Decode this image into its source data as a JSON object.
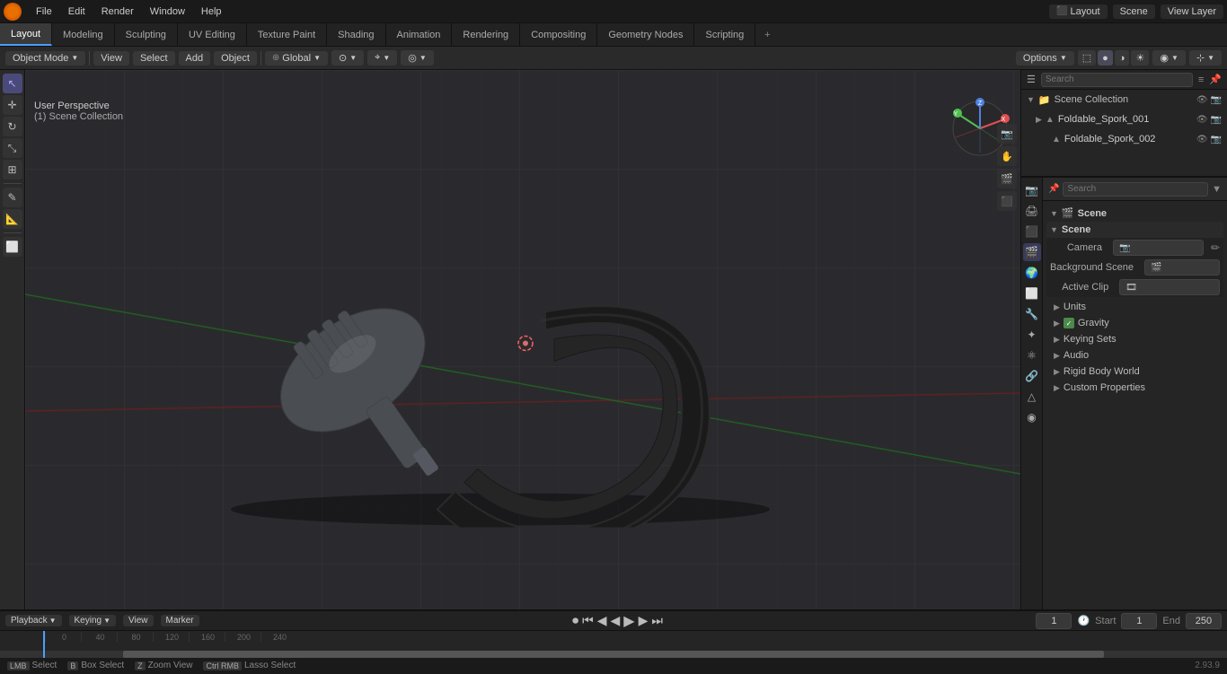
{
  "app": {
    "title": "Blender",
    "version": "2.93.9"
  },
  "top_menu": {
    "items": [
      "File",
      "Edit",
      "Render",
      "Window",
      "Help"
    ]
  },
  "workspace_tabs": {
    "tabs": [
      "Layout",
      "Modeling",
      "Sculpting",
      "UV Editing",
      "Texture Paint",
      "Shading",
      "Animation",
      "Rendering",
      "Compositing",
      "Geometry Nodes",
      "Scripting"
    ],
    "active": "Layout"
  },
  "header_tools": {
    "mode": "Object Mode",
    "view_label": "View",
    "select_label": "Select",
    "add_label": "Add",
    "object_label": "Object",
    "transform": "Global",
    "pivot": "⊙"
  },
  "viewport": {
    "view_label": "User Perspective",
    "scene_label": "(1) Scene Collection"
  },
  "outliner": {
    "title": "Scene Collection",
    "search_placeholder": "Search",
    "items": [
      {
        "name": "Scene Collection",
        "indent": 0,
        "type": "collection",
        "expanded": true
      },
      {
        "name": "Foldable_Spork_001",
        "indent": 1,
        "type": "mesh",
        "visible": true
      },
      {
        "name": "Foldable_Spork_002",
        "indent": 2,
        "type": "mesh",
        "visible": true
      }
    ]
  },
  "properties": {
    "search_placeholder": "Search",
    "active_tab": "scene",
    "scene_section": {
      "label": "Scene",
      "camera_label": "Camera",
      "camera_value": "",
      "background_scene_label": "Background Scene",
      "active_clip_label": "Active Clip",
      "units_label": "Units",
      "gravity_label": "Gravity",
      "gravity_checked": true,
      "keying_sets_label": "Keying Sets",
      "audio_label": "Audio",
      "rigid_body_world_label": "Rigid Body World",
      "custom_properties_label": "Custom Properties"
    }
  },
  "timeline": {
    "playback_label": "Playback",
    "keying_label": "Keying",
    "view_label": "View",
    "marker_label": "Marker",
    "frame_current": "1",
    "start_label": "Start",
    "start_value": "1",
    "end_label": "End",
    "end_value": "250",
    "ruler_marks": [
      "0",
      "40",
      "80",
      "120",
      "160",
      "200",
      "240"
    ]
  },
  "status_bar": {
    "select_label": "Select",
    "box_select_label": "Box Select",
    "zoom_view_label": "Zoom View",
    "lasso_select_label": "Lasso Select",
    "version": "2.93.9"
  },
  "icons": {
    "expand": "▶",
    "collapse": "▼",
    "mesh": "▲",
    "collection": "📁",
    "scene": "🎬",
    "camera": "📷",
    "eye": "👁",
    "check": "✓",
    "plus": "+",
    "search": "🔍",
    "filter": "≡",
    "play": "▶",
    "pause": "⏸",
    "skip_start": "⏮",
    "skip_end": "⏭",
    "prev_frame": "◀",
    "next_frame": "▶",
    "jump_start": "⏮",
    "jump_end": "⏭",
    "record": "⏺",
    "pin": "📌"
  }
}
